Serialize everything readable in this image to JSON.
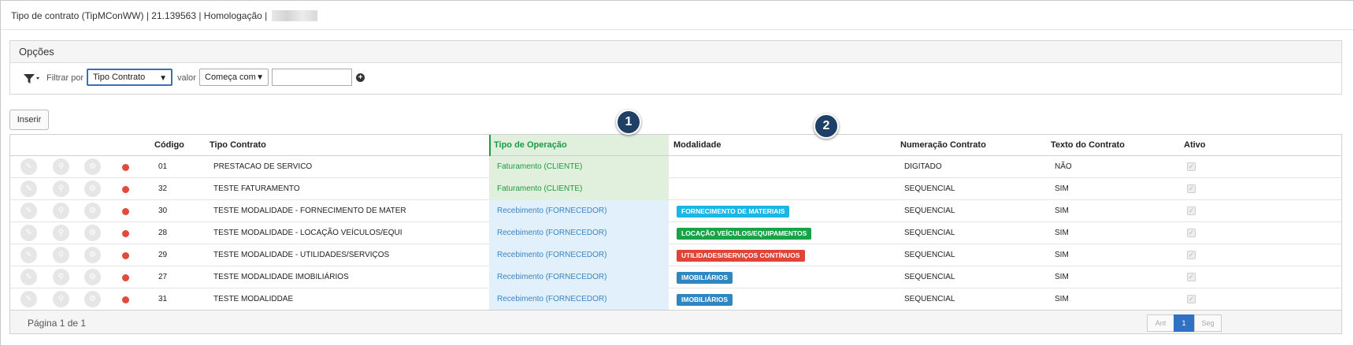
{
  "window": {
    "title": "Tipo de contrato (TipMConWW) | 21.139563 | Homologação |"
  },
  "options": {
    "heading": "Opções",
    "filter_icon": "filter-dropdown-icon",
    "filter_label": "Filtrar por",
    "filter_field_value": "Tipo Contrato",
    "value_label": "valor",
    "operator_value": "Começa com",
    "search_value": "",
    "add_icon": "plus-circle-icon"
  },
  "toolbar": {
    "insert_label": "Inserir"
  },
  "markers": [
    "1",
    "2"
  ],
  "grid": {
    "columns": [
      "Código",
      "Tipo Contrato",
      "Tipo de Operação",
      "Modalidade",
      "Numeração Contrato",
      "Texto do Contrato",
      "Ativo"
    ],
    "rows": [
      {
        "codigo": "01",
        "tipo": "PRESTACAO DE SERVICO",
        "operacao": "Faturamento (CLIENTE)",
        "op_kind": "cliente",
        "modalidade": "",
        "mod_color": "",
        "numeracao": "DIGITADO",
        "texto": "NÃO",
        "ativo": true
      },
      {
        "codigo": "32",
        "tipo": "TESTE FATURAMENTO",
        "operacao": "Faturamento (CLIENTE)",
        "op_kind": "cliente",
        "modalidade": "",
        "mod_color": "",
        "numeracao": "SEQUENCIAL",
        "texto": "SIM",
        "ativo": true
      },
      {
        "codigo": "30",
        "tipo": "TESTE MODALIDADE - FORNECIMENTO DE MATER",
        "operacao": "Recebimento (FORNECEDOR)",
        "op_kind": "fornecedor",
        "modalidade": "FORNECIMENTO DE MATERIAIS",
        "mod_color": "#18b7e6",
        "numeracao": "SEQUENCIAL",
        "texto": "SIM",
        "ativo": true
      },
      {
        "codigo": "28",
        "tipo": "TESTE MODALIDADE - LOCAÇÃO VEÍCULOS/EQUI",
        "operacao": "Recebimento (FORNECEDOR)",
        "op_kind": "fornecedor",
        "modalidade": "LOCAÇÃO VEÍCULOS/EQUIPAMENTOS",
        "mod_color": "#18a349",
        "numeracao": "SEQUENCIAL",
        "texto": "SIM",
        "ativo": true
      },
      {
        "codigo": "29",
        "tipo": "TESTE MODALIDADE - UTILIDADES/SERVIÇOS",
        "operacao": "Recebimento (FORNECEDOR)",
        "op_kind": "fornecedor",
        "modalidade": "UTILIDADES/SERVIÇOS CONTÍNUOS",
        "mod_color": "#e04438",
        "numeracao": "SEQUENCIAL",
        "texto": "SIM",
        "ativo": true
      },
      {
        "codigo": "27",
        "tipo": "TESTE MODALIDADE IMOBILIÁRIOS",
        "operacao": "Recebimento (FORNECEDOR)",
        "op_kind": "fornecedor",
        "modalidade": "IMOBILIÁRIOS",
        "mod_color": "#2f87c2",
        "numeracao": "SEQUENCIAL",
        "texto": "SIM",
        "ativo": true
      },
      {
        "codigo": "31",
        "tipo": "TESTE MODALIDDAE",
        "operacao": "Recebimento (FORNECEDOR)",
        "op_kind": "fornecedor",
        "modalidade": "IMOBILIÁRIOS",
        "mod_color": "#2f87c2",
        "numeracao": "SEQUENCIAL",
        "texto": "SIM",
        "ativo": true
      }
    ],
    "row_action_icons": [
      "edit-icon",
      "view-icon",
      "settings-icon",
      "status-dot-icon"
    ],
    "colors": {
      "cliente_bg": "#e1f0dc",
      "cliente_text": "#1e9a43",
      "fornecedor_bg": "#e1f0fb",
      "fornecedor_text": "#3b84c4",
      "header_op_text": "#1b9a48",
      "status_dot": "#e24a3b"
    }
  },
  "footer": {
    "page_text": "Página 1 de 1",
    "prev_label": "Ant",
    "current_page": "1",
    "next_label": "Seg"
  }
}
